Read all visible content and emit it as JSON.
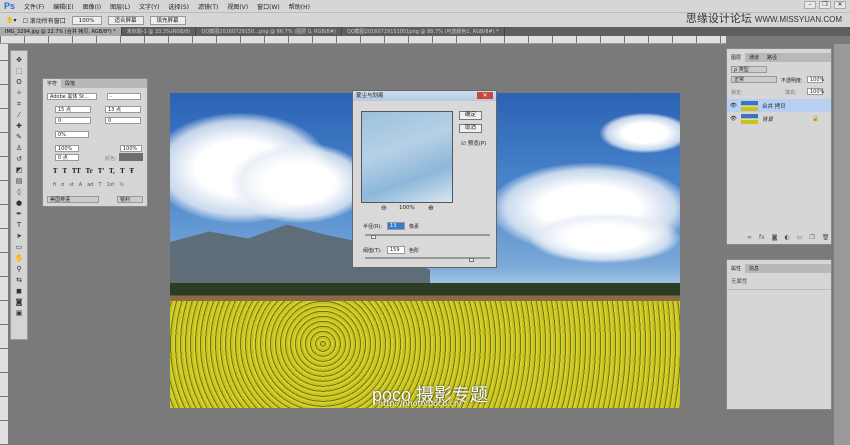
{
  "app": {
    "logo": "Ps",
    "menu": [
      "文件(F)",
      "编辑(E)",
      "图像(I)",
      "图层(L)",
      "文字(Y)",
      "选择(S)",
      "滤镜(T)",
      "视图(V)",
      "窗口(W)",
      "帮助(H)"
    ],
    "window_controls": [
      "–",
      "❐",
      "✕"
    ]
  },
  "options": {
    "scroll_all": "滚动所有窗口",
    "zoom": "100%",
    "fit_screen": "适合屏幕",
    "fill_screen": "填充屏幕"
  },
  "watermark": {
    "cn": "思缘设计论坛",
    "url": "WWW.MISSYUAN.COM"
  },
  "tabs": [
    "IMG_3294.jpg @ 22.7% (合并 拷贝, RGB/8*) *",
    "未标题-1 @ 33.3%(RGB/8)",
    "QQ截图20160729150...png @ 66.7% (图层 0, RGB/8#)",
    "QQ截图20160729151051png @ 88.7% (可选颜色1, RGB/8#) *"
  ],
  "character": {
    "tabs": [
      "字符",
      "段落"
    ],
    "font": "Adobe 黑体 St...",
    "style": "-",
    "size": "15 点",
    "leading": "13 点",
    "kerning": "0",
    "tracking": "0",
    "scale_pct": "0%",
    "vscale": "100%",
    "hscale": "100%",
    "baseline": "0 点",
    "color_label": "颜色:",
    "styles": [
      "T",
      "T",
      "TT",
      "Tr",
      "T'",
      "T,",
      "T",
      "Ŧ"
    ],
    "opentype": [
      "fi",
      "ơ",
      "st",
      "A",
      "ad",
      "T",
      "1st",
      "½"
    ],
    "language": "美国英语",
    "aa": "锐利"
  },
  "dialog": {
    "title": "蒙尘与划痕",
    "ok": "确定",
    "cancel": "取消",
    "preview_label": "预览(P)",
    "preview_checked": true,
    "zoom": "100%",
    "radius_label": "半径(R):",
    "radius": "13",
    "radius_unit": "像素",
    "threshold_label": "阈值(T):",
    "threshold": "159",
    "threshold_unit": "色阶"
  },
  "layers": {
    "tabs": [
      "图层",
      "通道",
      "路径"
    ],
    "filter": "ρ 类型",
    "blend": "正常",
    "opacity_label": "不透明度:",
    "opacity": "100%",
    "lock_label": "锁定:",
    "fill_label": "填充:",
    "fill": "100%",
    "items": [
      {
        "name": "合并 拷贝",
        "selected": true
      },
      {
        "name": "背景",
        "locked": true
      }
    ]
  },
  "properties": {
    "tabs": [
      "属性",
      "信息"
    ],
    "text": "无属性"
  },
  "photo_watermark": {
    "brand": "poco 摄影专题",
    "url": "http://photo.poco.cn/"
  }
}
